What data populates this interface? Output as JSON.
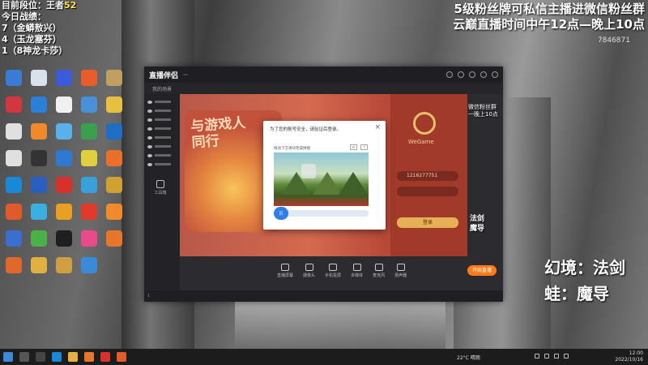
{
  "overlay_top_left": {
    "line1": "目前段位：王者",
    "line1_num": "52",
    "line2": "今日战绩：",
    "line3": "7（金蟒敖兴）",
    "line4": "4（玉龙塞芬）",
    "line5": "1（8神龙卡莎）"
  },
  "overlay_top_right": {
    "line1": "5级粉丝牌可私信主播进微信粉丝群",
    "line2": "云巅直播时间中午12点—晚上10点",
    "room_id": "7846871"
  },
  "desktop": {
    "icons": [
      {
        "label": "",
        "color": "#3a7bd5"
      },
      {
        "label": "",
        "color": "#d9e1ea"
      },
      {
        "label": "",
        "color": "#3b5bdb"
      },
      {
        "label": "",
        "color": "#e85d2a"
      },
      {
        "label": "",
        "color": "#c0a060"
      },
      {
        "label": "",
        "color": "#d2363f"
      },
      {
        "label": "",
        "color": "#2b7fd5"
      },
      {
        "label": "",
        "color": "#f0f0f0"
      },
      {
        "label": "",
        "color": "#4a90d9"
      },
      {
        "label": "",
        "color": "#e8c040"
      },
      {
        "label": "",
        "color": "#e0e0e0"
      },
      {
        "label": "",
        "color": "#ee8a2a"
      },
      {
        "label": "",
        "color": "#5ab0e8"
      },
      {
        "label": "",
        "color": "#3aa050"
      },
      {
        "label": "",
        "color": "#1e6fc4"
      },
      {
        "label": "",
        "color": "#e0e0e0"
      },
      {
        "label": "",
        "color": "#333333"
      },
      {
        "label": "",
        "color": "#2f7ad0"
      },
      {
        "label": "",
        "color": "#e0d040"
      },
      {
        "label": "",
        "color": "#e8702a"
      },
      {
        "label": "",
        "color": "#1a88d8"
      },
      {
        "label": "",
        "color": "#2a5fc0"
      },
      {
        "label": "",
        "color": "#d8302a"
      },
      {
        "label": "",
        "color": "#3aa0d8"
      },
      {
        "label": "",
        "color": "#d0a030"
      },
      {
        "label": "",
        "color": "#e05a2a"
      },
      {
        "label": "",
        "color": "#3bb0e0"
      },
      {
        "label": "",
        "color": "#e8a020"
      },
      {
        "label": "",
        "color": "#e03a2a"
      },
      {
        "label": "",
        "color": "#f08a2a"
      },
      {
        "label": "",
        "color": "#3a6fd0"
      },
      {
        "label": "",
        "color": "#4ab048"
      },
      {
        "label": "",
        "color": "#1f1f1f"
      },
      {
        "label": "",
        "color": "#e84a8a"
      },
      {
        "label": "",
        "color": "#e8762a"
      },
      {
        "label": "",
        "color": "#e0682a"
      },
      {
        "label": "",
        "color": "#e0b040"
      },
      {
        "label": "",
        "color": "#d0a040"
      },
      {
        "label": "",
        "color": "#3a8ad8"
      }
    ]
  },
  "app": {
    "logo": "直播伴侣",
    "version": "",
    "tabs": [
      "我的场景",
      "",
      "",
      "",
      "",
      "",
      ""
    ],
    "active_tab_index": 2,
    "side_rows": 8,
    "side_buttons": [
      "工具箱",
      "",
      "",
      "",
      ""
    ],
    "poster_text": "与游戏人\n同行",
    "wegame": {
      "name": "WeGame",
      "account": "1216277751",
      "password": "",
      "login": "登录",
      "sub": ""
    },
    "toolbar": [
      {
        "name": "live-mode-button",
        "label": "直播屏幕"
      },
      {
        "name": "camera-button",
        "label": "摄像头"
      },
      {
        "name": "phone-cast-button",
        "label": "手机投屏"
      },
      {
        "name": "multi-stream-button",
        "label": "多媒体"
      },
      {
        "name": "mic-button",
        "label": "麦克风"
      },
      {
        "name": "speaker-button",
        "label": "扬声器"
      }
    ],
    "live_button": "开始直播",
    "status": "1"
  },
  "dialog": {
    "title": "为了您的账号安全，请验证后登录。",
    "hint": "拖动下方滑块完成拼图",
    "slider_label": "|||",
    "slider_progress": 0.14
  },
  "right_overlay": {
    "tag": "微信粉丝群\n一晚上10点",
    "small_line1": "法剑",
    "small_line2": "魔导",
    "big_line1": "幻境：法剑",
    "big_line2": "蛙：魔导"
  },
  "taskbar": {
    "weather": "22°C 晴朗",
    "time": "12:00",
    "date": "2022/10/16"
  }
}
